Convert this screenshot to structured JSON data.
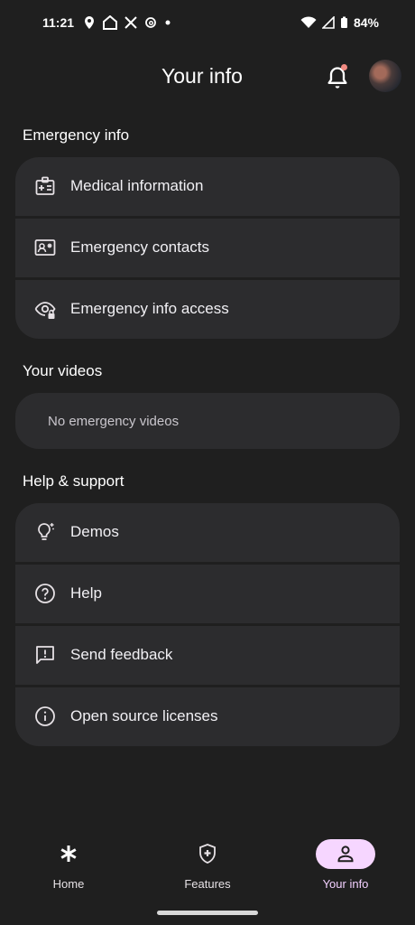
{
  "status_bar": {
    "time": "11:21",
    "battery": "84%"
  },
  "header": {
    "title": "Your info"
  },
  "sections": {
    "emergency": {
      "title": "Emergency info",
      "items": [
        {
          "label": "Medical information",
          "icon": "medical-id-icon"
        },
        {
          "label": "Emergency contacts",
          "icon": "contact-card-icon"
        },
        {
          "label": "Emergency info access",
          "icon": "eye-lock-icon"
        }
      ]
    },
    "videos": {
      "title": "Your videos",
      "empty_text": "No emergency videos"
    },
    "help": {
      "title": "Help & support",
      "items": [
        {
          "label": "Demos",
          "icon": "lightbulb-icon"
        },
        {
          "label": "Help",
          "icon": "help-circle-icon"
        },
        {
          "label": "Send feedback",
          "icon": "feedback-icon"
        },
        {
          "label": "Open source licenses",
          "icon": "info-icon"
        }
      ]
    }
  },
  "bottom_nav": {
    "items": [
      {
        "label": "Home",
        "icon": "asterisk-icon"
      },
      {
        "label": "Features",
        "icon": "shield-plus-icon"
      },
      {
        "label": "Your info",
        "icon": "person-icon",
        "selected": true
      }
    ]
  },
  "colors": {
    "background": "#1f1f1f",
    "card": "#2c2c2e",
    "accent_pill": "#f6d6ff",
    "notification_dot": "#f28b82"
  }
}
